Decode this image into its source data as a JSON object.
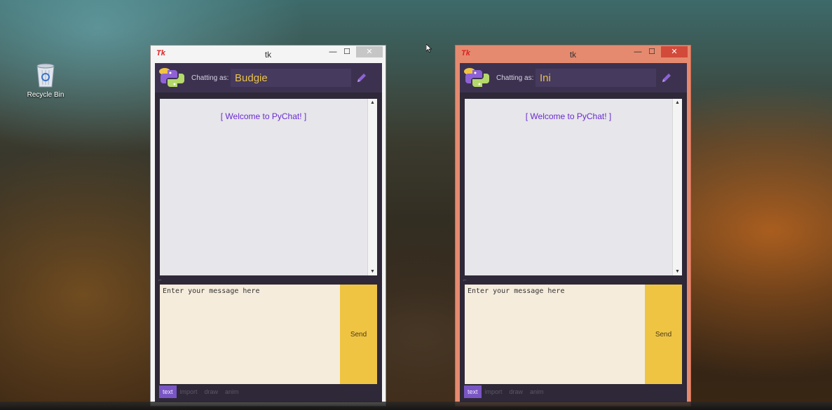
{
  "desktop": {
    "recycle_bin_label": "Recycle Bin"
  },
  "windows": [
    {
      "title": "tk",
      "app_icon": "Tk",
      "state": "inactive",
      "controls": {
        "minimize": "—",
        "maximize": "☐",
        "close": "✕"
      },
      "chatting_as_label": "Chatting as:",
      "username": "Budgie",
      "welcome_message": "[ Welcome to PyChat! ]",
      "message_placeholder": "Enter your message here",
      "send_label": "Send",
      "modes": [
        "text",
        "import",
        "draw",
        "anim"
      ],
      "selected_mode": "text"
    },
    {
      "title": "tk",
      "app_icon": "Tk",
      "state": "active",
      "controls": {
        "minimize": "—",
        "maximize": "☐",
        "close": "✕"
      },
      "chatting_as_label": "Chatting as:",
      "username": "Ini",
      "welcome_message": "[ Welcome to PyChat! ]",
      "message_placeholder": "Enter your message here",
      "send_label": "Send",
      "modes": [
        "text",
        "import",
        "draw",
        "anim"
      ],
      "selected_mode": "text"
    }
  ],
  "icons": {
    "app_logo": "python-logo-icon",
    "edit_name": "pencil-icon",
    "recycle_bin": "recycle-bin-icon",
    "cursor": "mouse-cursor-icon"
  },
  "colors": {
    "header": "#3c3250",
    "send_button": "#f0c443",
    "entry_background": "#f6ecdc",
    "welcome_text": "#6a2cd0",
    "username_text": "#e9c24a",
    "selected_mode": "#7a55c4",
    "active_frame": "#e58a6f"
  }
}
